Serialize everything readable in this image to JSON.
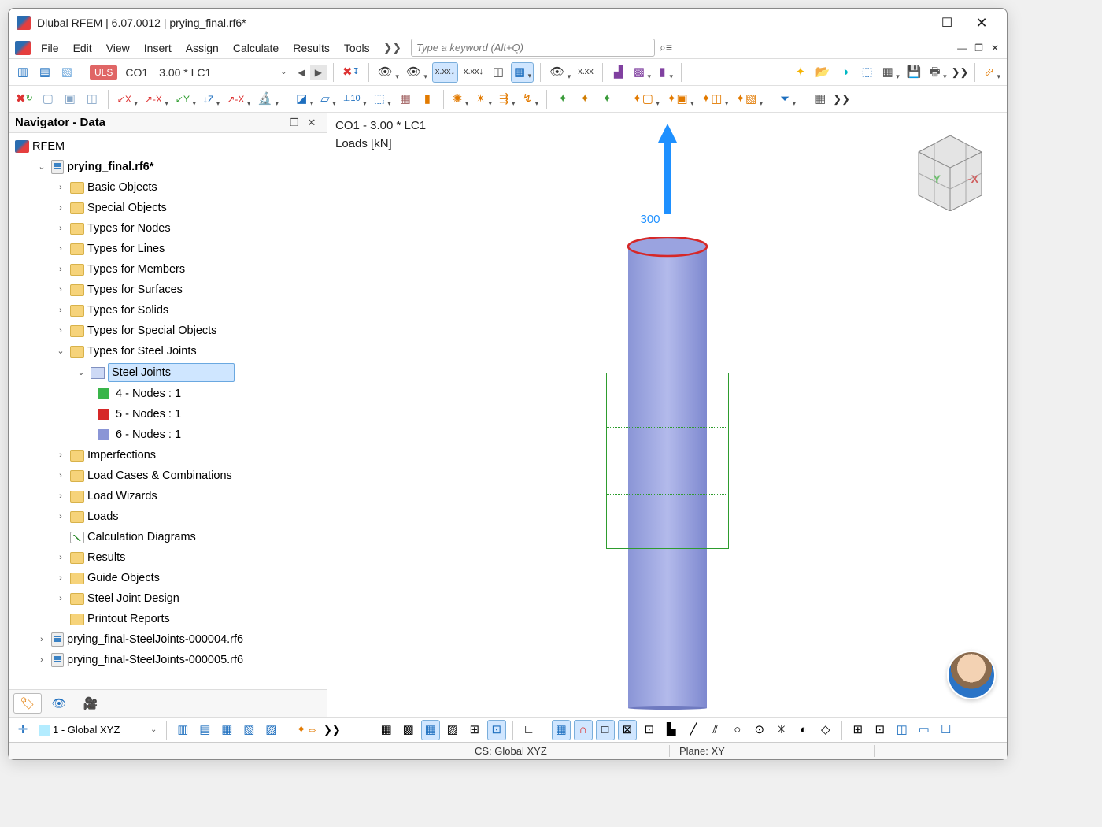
{
  "window": {
    "title": "Dlubal RFEM | 6.07.0012 | prying_final.rf6*"
  },
  "menus": [
    "File",
    "Edit",
    "View",
    "Insert",
    "Assign",
    "Calculate",
    "Results",
    "Tools"
  ],
  "search": {
    "placeholder": "Type a keyword (Alt+Q)"
  },
  "loadcase": {
    "badge": "ULS",
    "name": "CO1",
    "value": "3.00 * LC1"
  },
  "navigator": {
    "title": "Navigator - Data",
    "root": "RFEM",
    "model": "prying_final.rf6*",
    "folders_top": [
      "Basic Objects",
      "Special Objects",
      "Types for Nodes",
      "Types for Lines",
      "Types for Members",
      "Types for Surfaces",
      "Types for Solids",
      "Types for Special Objects"
    ],
    "steel_category": "Types for Steel Joints",
    "steel_joints_label": "Steel Joints",
    "joints": [
      {
        "label": "4 - Nodes : 1",
        "color": "#39b54a"
      },
      {
        "label": "5 - Nodes : 1",
        "color": "#d62828"
      },
      {
        "label": "6 - Nodes : 1",
        "color": "#8a95d6"
      }
    ],
    "folders_bottom": [
      "Imperfections",
      "Load Cases & Combinations",
      "Load Wizards",
      "Loads"
    ],
    "calc_diagrams": "Calculation Diagrams",
    "folders_bottom2": [
      "Results",
      "Guide Objects",
      "Steel Joint Design",
      "Printout Reports"
    ],
    "extra_files": [
      "prying_final-SteelJoints-000004.rf6",
      "prying_final-SteelJoints-000005.rf6"
    ]
  },
  "viewport": {
    "line1": "CO1 - 3.00 * LC1",
    "line2": "Loads [kN]",
    "load_value": "300"
  },
  "coord_system": {
    "value": "1 - Global XYZ"
  },
  "status": {
    "cs": "CS: Global XYZ",
    "plane": "Plane: XY"
  }
}
